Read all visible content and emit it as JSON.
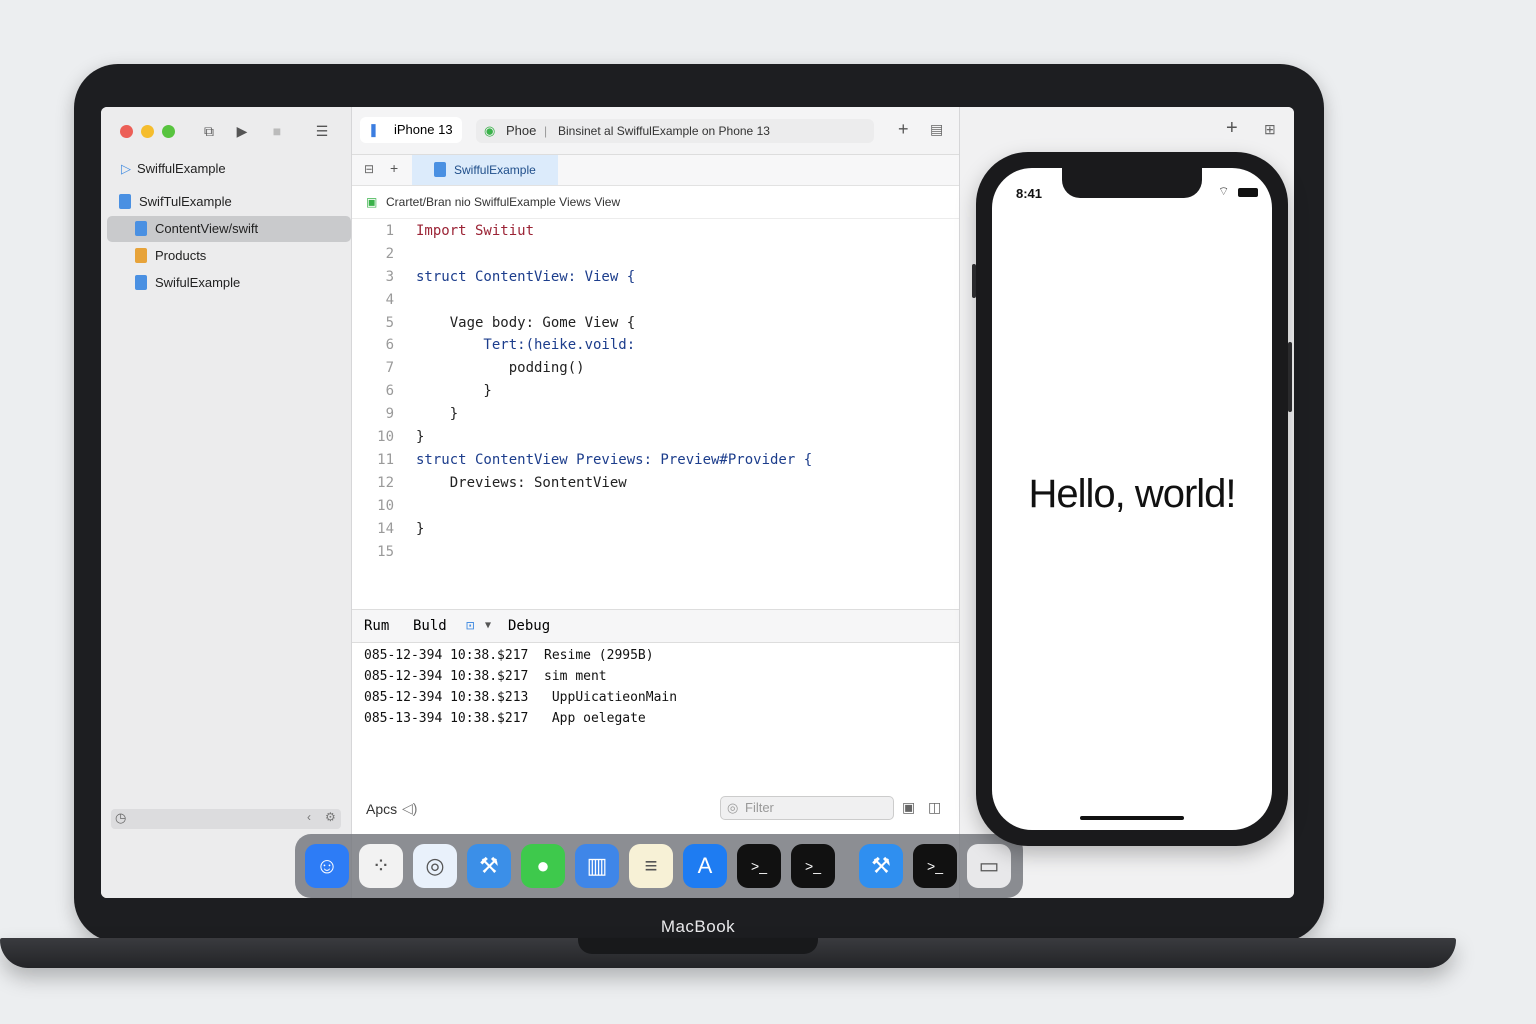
{
  "laptop": {
    "brand": "MacBook"
  },
  "window": {
    "toolbar": {
      "scheme_device": "iPhone 13",
      "status_app": "Phoe",
      "status_text": "Binsinet al SwiffulExample on Phone 13"
    },
    "sidebar": {
      "project": "SwiffulExample",
      "items": [
        {
          "label": "SwifTulExample",
          "icon": "swift-file-icon"
        },
        {
          "label": "ContentView/swift",
          "icon": "swift-file-icon",
          "selected": true
        },
        {
          "label": "Products",
          "icon": "folder-icon"
        },
        {
          "label": "SwifulExample",
          "icon": "app-file-icon"
        }
      ]
    },
    "editor": {
      "active_tab": "SwiffulExample",
      "breadcrumb": "Crartet/Bran nio SwiffulExample  Views View",
      "code": [
        {
          "n": "1",
          "t": "Import Switiut"
        },
        {
          "n": "2",
          "t": ""
        },
        {
          "n": "3",
          "t": "struct ContentView: View {"
        },
        {
          "n": "4",
          "t": ""
        },
        {
          "n": "5",
          "t": "    Vage body: Gome View {"
        },
        {
          "n": "6",
          "t": "        Tert:(heike.voild:"
        },
        {
          "n": "7",
          "t": "           podding()"
        },
        {
          "n": "6",
          "t": "        }"
        },
        {
          "n": "9",
          "t": "    }"
        },
        {
          "n": "10",
          "t": "}"
        },
        {
          "n": "11",
          "t": "struct ContentView Previews: Preview#Provider {"
        },
        {
          "n": "12",
          "t": "    Dreviews: SontentView"
        },
        {
          "n": "10",
          "t": ""
        },
        {
          "n": "14",
          "t": "}"
        },
        {
          "n": "15",
          "t": ""
        }
      ]
    },
    "debug_bar": {
      "run": "Rum",
      "build": "Buld",
      "debug": "Debug"
    },
    "console": [
      "085-12-394 10:38.$217  Resime (2995B)",
      "085-12-394 10:38.$217  sim ment",
      "085-12-394 10:38.$213   UppUicatieonMain",
      "085-13-394 10:38.$217   App oelegate"
    ],
    "bottom": {
      "label": "Apcs",
      "filter_placeholder": "Filter"
    }
  },
  "phone": {
    "time": "8:41",
    "content": "Hello, world!"
  },
  "dock": [
    {
      "name": "finder-icon",
      "bg": "#2d7cf6"
    },
    {
      "name": "launchpad-icon",
      "bg": "#f2f2f2"
    },
    {
      "name": "safari-icon",
      "bg": "#e9f1fb"
    },
    {
      "name": "xcode-icon",
      "bg": "#3b8fe8"
    },
    {
      "name": "messages-icon",
      "bg": "#3ec94c"
    },
    {
      "name": "files-icon",
      "bg": "#3f86e8"
    },
    {
      "name": "notes-icon",
      "bg": "#f7f1d6"
    },
    {
      "name": "app-store-icon",
      "bg": "#1e7cf2"
    },
    {
      "name": "terminal-icon",
      "bg": "#111"
    },
    {
      "name": "terminal-icon",
      "bg": "#111"
    },
    {
      "name": "xcode-icon",
      "bg": "#2f8ff0"
    },
    {
      "name": "terminal-icon",
      "bg": "#111"
    },
    {
      "name": "trash-icon",
      "bg": "#e8e8ea"
    }
  ]
}
